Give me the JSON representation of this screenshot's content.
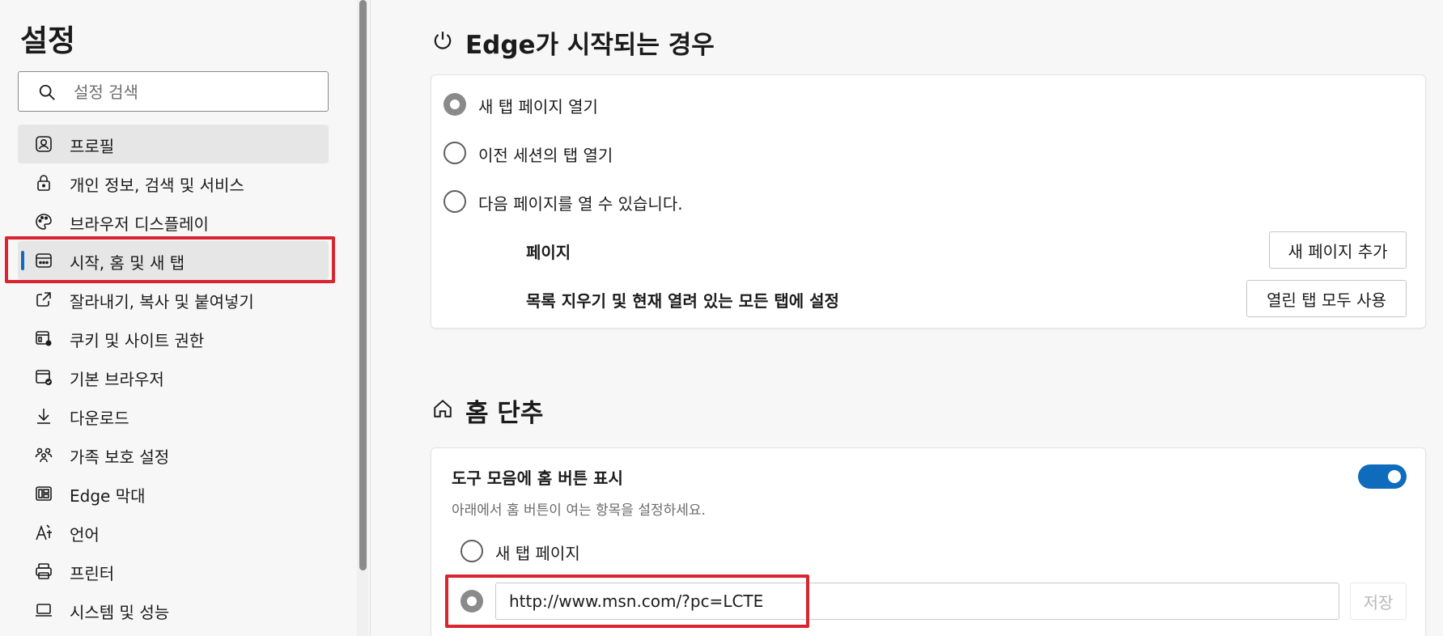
{
  "sidebar": {
    "title": "설정",
    "search_placeholder": "설정 검색",
    "items": [
      {
        "label": "프로필",
        "icon": "profile-icon"
      },
      {
        "label": "개인 정보, 검색 및 서비스",
        "icon": "lock-icon"
      },
      {
        "label": "브라우저 디스플레이",
        "icon": "palette-icon"
      },
      {
        "label": "시작, 홈 및 새 탭",
        "icon": "start-home-icon"
      },
      {
        "label": "잘라내기, 복사 및 붙여넣기",
        "icon": "share-icon"
      },
      {
        "label": "쿠키 및 사이트 권한",
        "icon": "site-permissions-icon"
      },
      {
        "label": "기본 브라우저",
        "icon": "default-browser-icon"
      },
      {
        "label": "다운로드",
        "icon": "download-icon"
      },
      {
        "label": "가족 보호 설정",
        "icon": "family-icon"
      },
      {
        "label": "Edge 막대",
        "icon": "edge-bar-icon"
      },
      {
        "label": "언어",
        "icon": "language-icon"
      },
      {
        "label": "프린터",
        "icon": "printer-icon"
      },
      {
        "label": "시스템 및 성능",
        "icon": "laptop-icon"
      }
    ]
  },
  "startup": {
    "title": "Edge가 시작되는 경우",
    "options": [
      {
        "label": "새 탭 페이지 열기",
        "checked": true
      },
      {
        "label": "이전 세션의 탭 열기",
        "checked": false
      },
      {
        "label": "다음 페이지를 열 수 있습니다.",
        "checked": false
      }
    ],
    "pages_label": "페이지",
    "add_page_button": "새 페이지 추가",
    "clear_label": "목록 지우기 및 현재 열려 있는 모든 탭에 설정",
    "use_open_tabs_button": "열린 탭 모두 사용"
  },
  "home": {
    "title": "홈 단추",
    "toggle_label": "도구 모음에 홈 버튼 표시",
    "toggle_on": true,
    "description": "아래에서 홈 버튼이 여는 항목을 설정하세요.",
    "option_new_tab": "새 탭 페이지",
    "url_value": "http://www.msn.com/?pc=LCTE",
    "save_button": "저장"
  },
  "colors": {
    "accent": "#0f6cbd",
    "highlight": "#d9252f"
  }
}
